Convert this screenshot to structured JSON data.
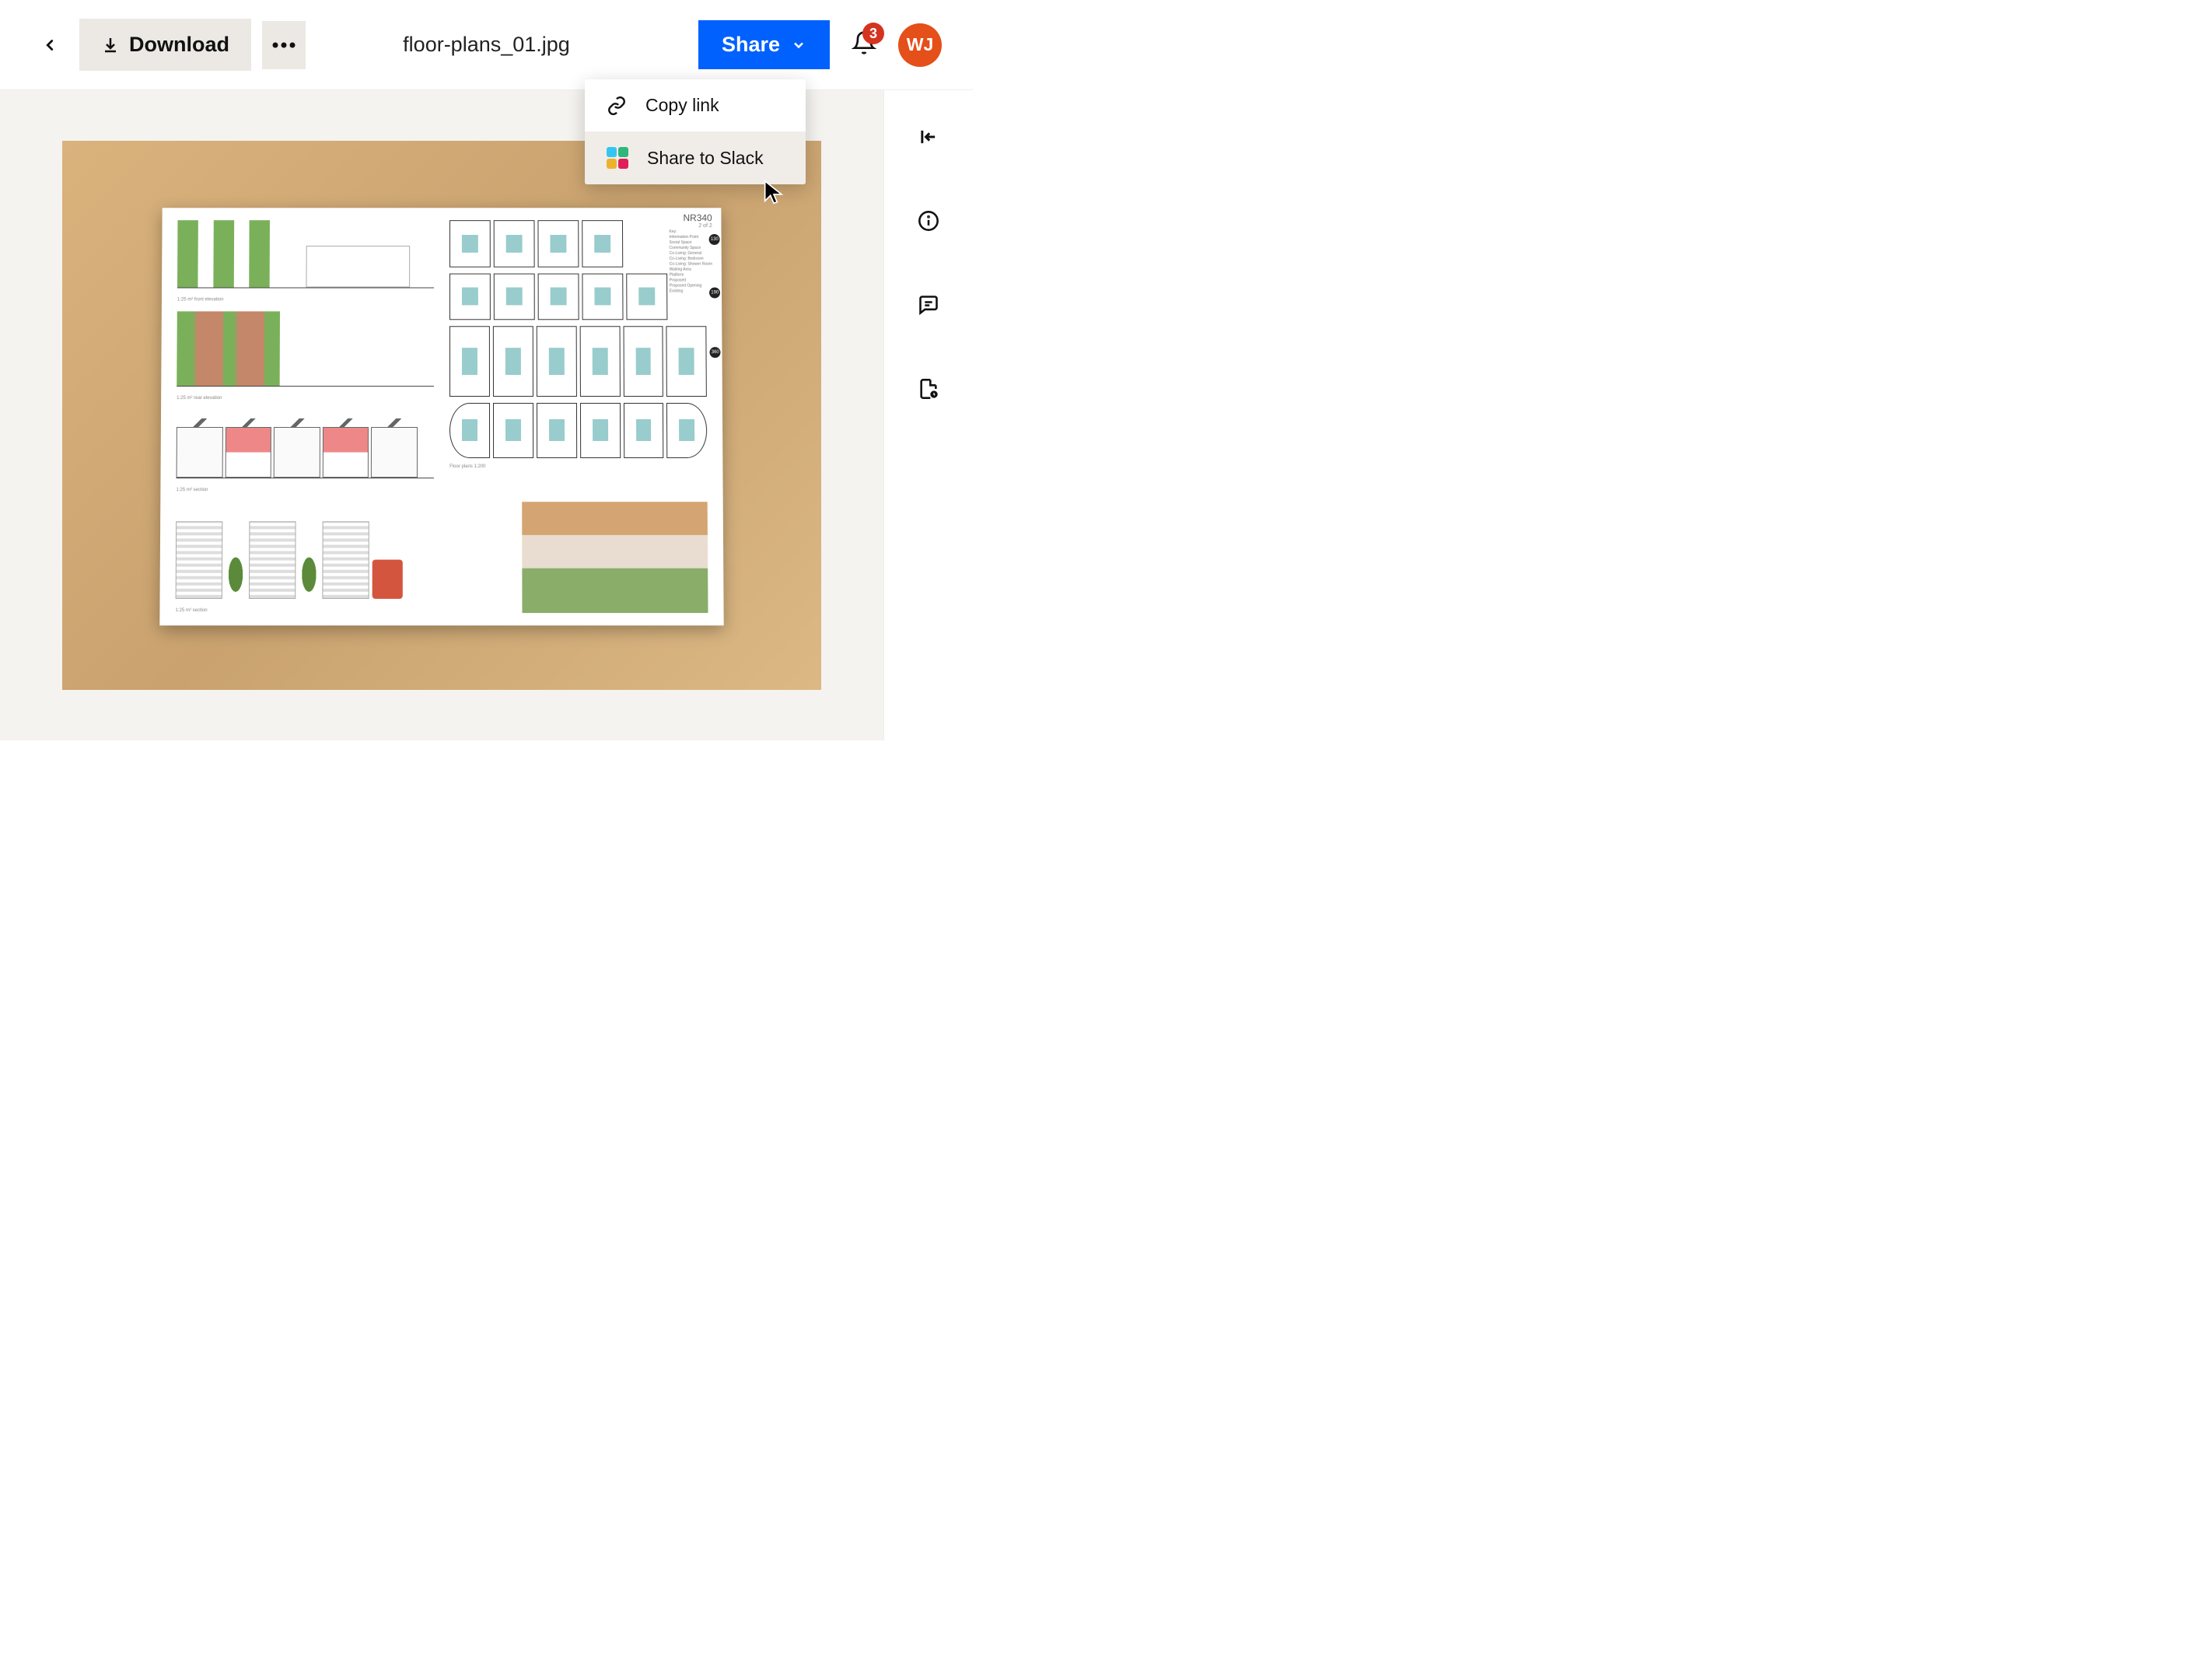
{
  "header": {
    "download_label": "Download",
    "filename": "floor-plans_01.jpg",
    "share_label": "Share",
    "notification_count": "3",
    "avatar_initials": "WJ"
  },
  "dropdown": {
    "copy_link_label": "Copy link",
    "share_slack_label": "Share to Slack"
  },
  "plan": {
    "title": "NR340",
    "subtitle": "2 of 2",
    "caption1": "1:25 m² front elevation",
    "caption2": "1:25 m² rear elevation",
    "caption3": "1:25 m² section",
    "caption4": "1:25 m² section",
    "floorplan_caption": "Floor plans 1:200",
    "sqm1": "130",
    "sqm2": "190",
    "sqm3": "360",
    "key_header": "Key:",
    "key_items": [
      "Information Point",
      "Social Space",
      "Community Space",
      "Co-Living: General",
      "Co-Living: Bedroom",
      "Co-Living: Shower Room",
      "Waiting Area",
      "Platform",
      "Proposed",
      "Proposed Opening",
      "Existing"
    ]
  }
}
